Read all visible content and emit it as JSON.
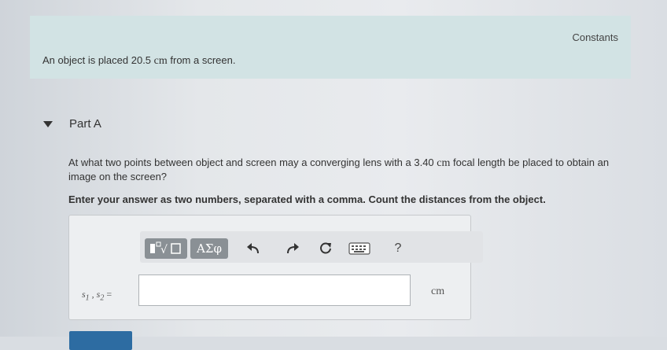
{
  "intro": {
    "constants_link": "Constants",
    "text_before": "An object is placed 20.5 ",
    "unit": "cm",
    "text_after": " from a screen."
  },
  "part": {
    "title": "Part A",
    "question_before": "At what two points between object and screen may a converging lens with a 3.40 ",
    "question_unit": "cm",
    "question_after": " focal length be placed to obtain an image on the screen?",
    "instruction": "Enter your answer as two numbers, separated with a comma. Count the distances from the object."
  },
  "toolbar": {
    "template_label": "√",
    "greek_label": "ΑΣφ",
    "help_label": "?",
    "icons": [
      "templates-icon",
      "greek-symbols-icon",
      "undo-icon",
      "redo-icon",
      "reset-icon",
      "keyboard-icon",
      "help-icon"
    ]
  },
  "answer": {
    "var_s": "s",
    "sub_1": "1",
    "separator": " , ",
    "sub_2": "2",
    "equals": " =",
    "input_value": "",
    "unit": "cm"
  },
  "colors": {
    "intro_bg": "#d2e3e4",
    "toolbar_button": "#8a9095",
    "submit": "#2d6ca2"
  }
}
